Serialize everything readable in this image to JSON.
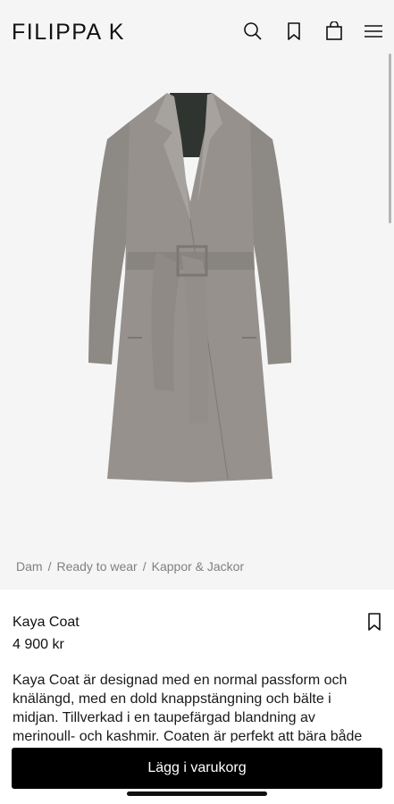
{
  "brand": {
    "logo": "FILIPPA K"
  },
  "header": {
    "icons": [
      "search-icon",
      "bookmark-icon",
      "shopping-bag-icon",
      "menu-icon"
    ]
  },
  "product": {
    "image_alt_color": "#8a8580",
    "breadcrumb": [
      "Dam",
      "Ready to wear",
      "Kappor & Jackor"
    ],
    "breadcrumb_sep": "/",
    "name": "Kaya Coat",
    "price": "4 900 kr",
    "description": "Kaya Coat är designad med en normal passform och knälängd, med en dold knappstängning och bälte i midjan. Tillverkad i en taupefärgad blandning av merinoull- och kashmir. Coaten är perfekt att bära både med ...",
    "add_to_cart": "Lägg i varukorg"
  },
  "colors": {
    "accent": "#000000",
    "hero_bg": "#f5f5f5",
    "breadcrumb": "#808080"
  }
}
